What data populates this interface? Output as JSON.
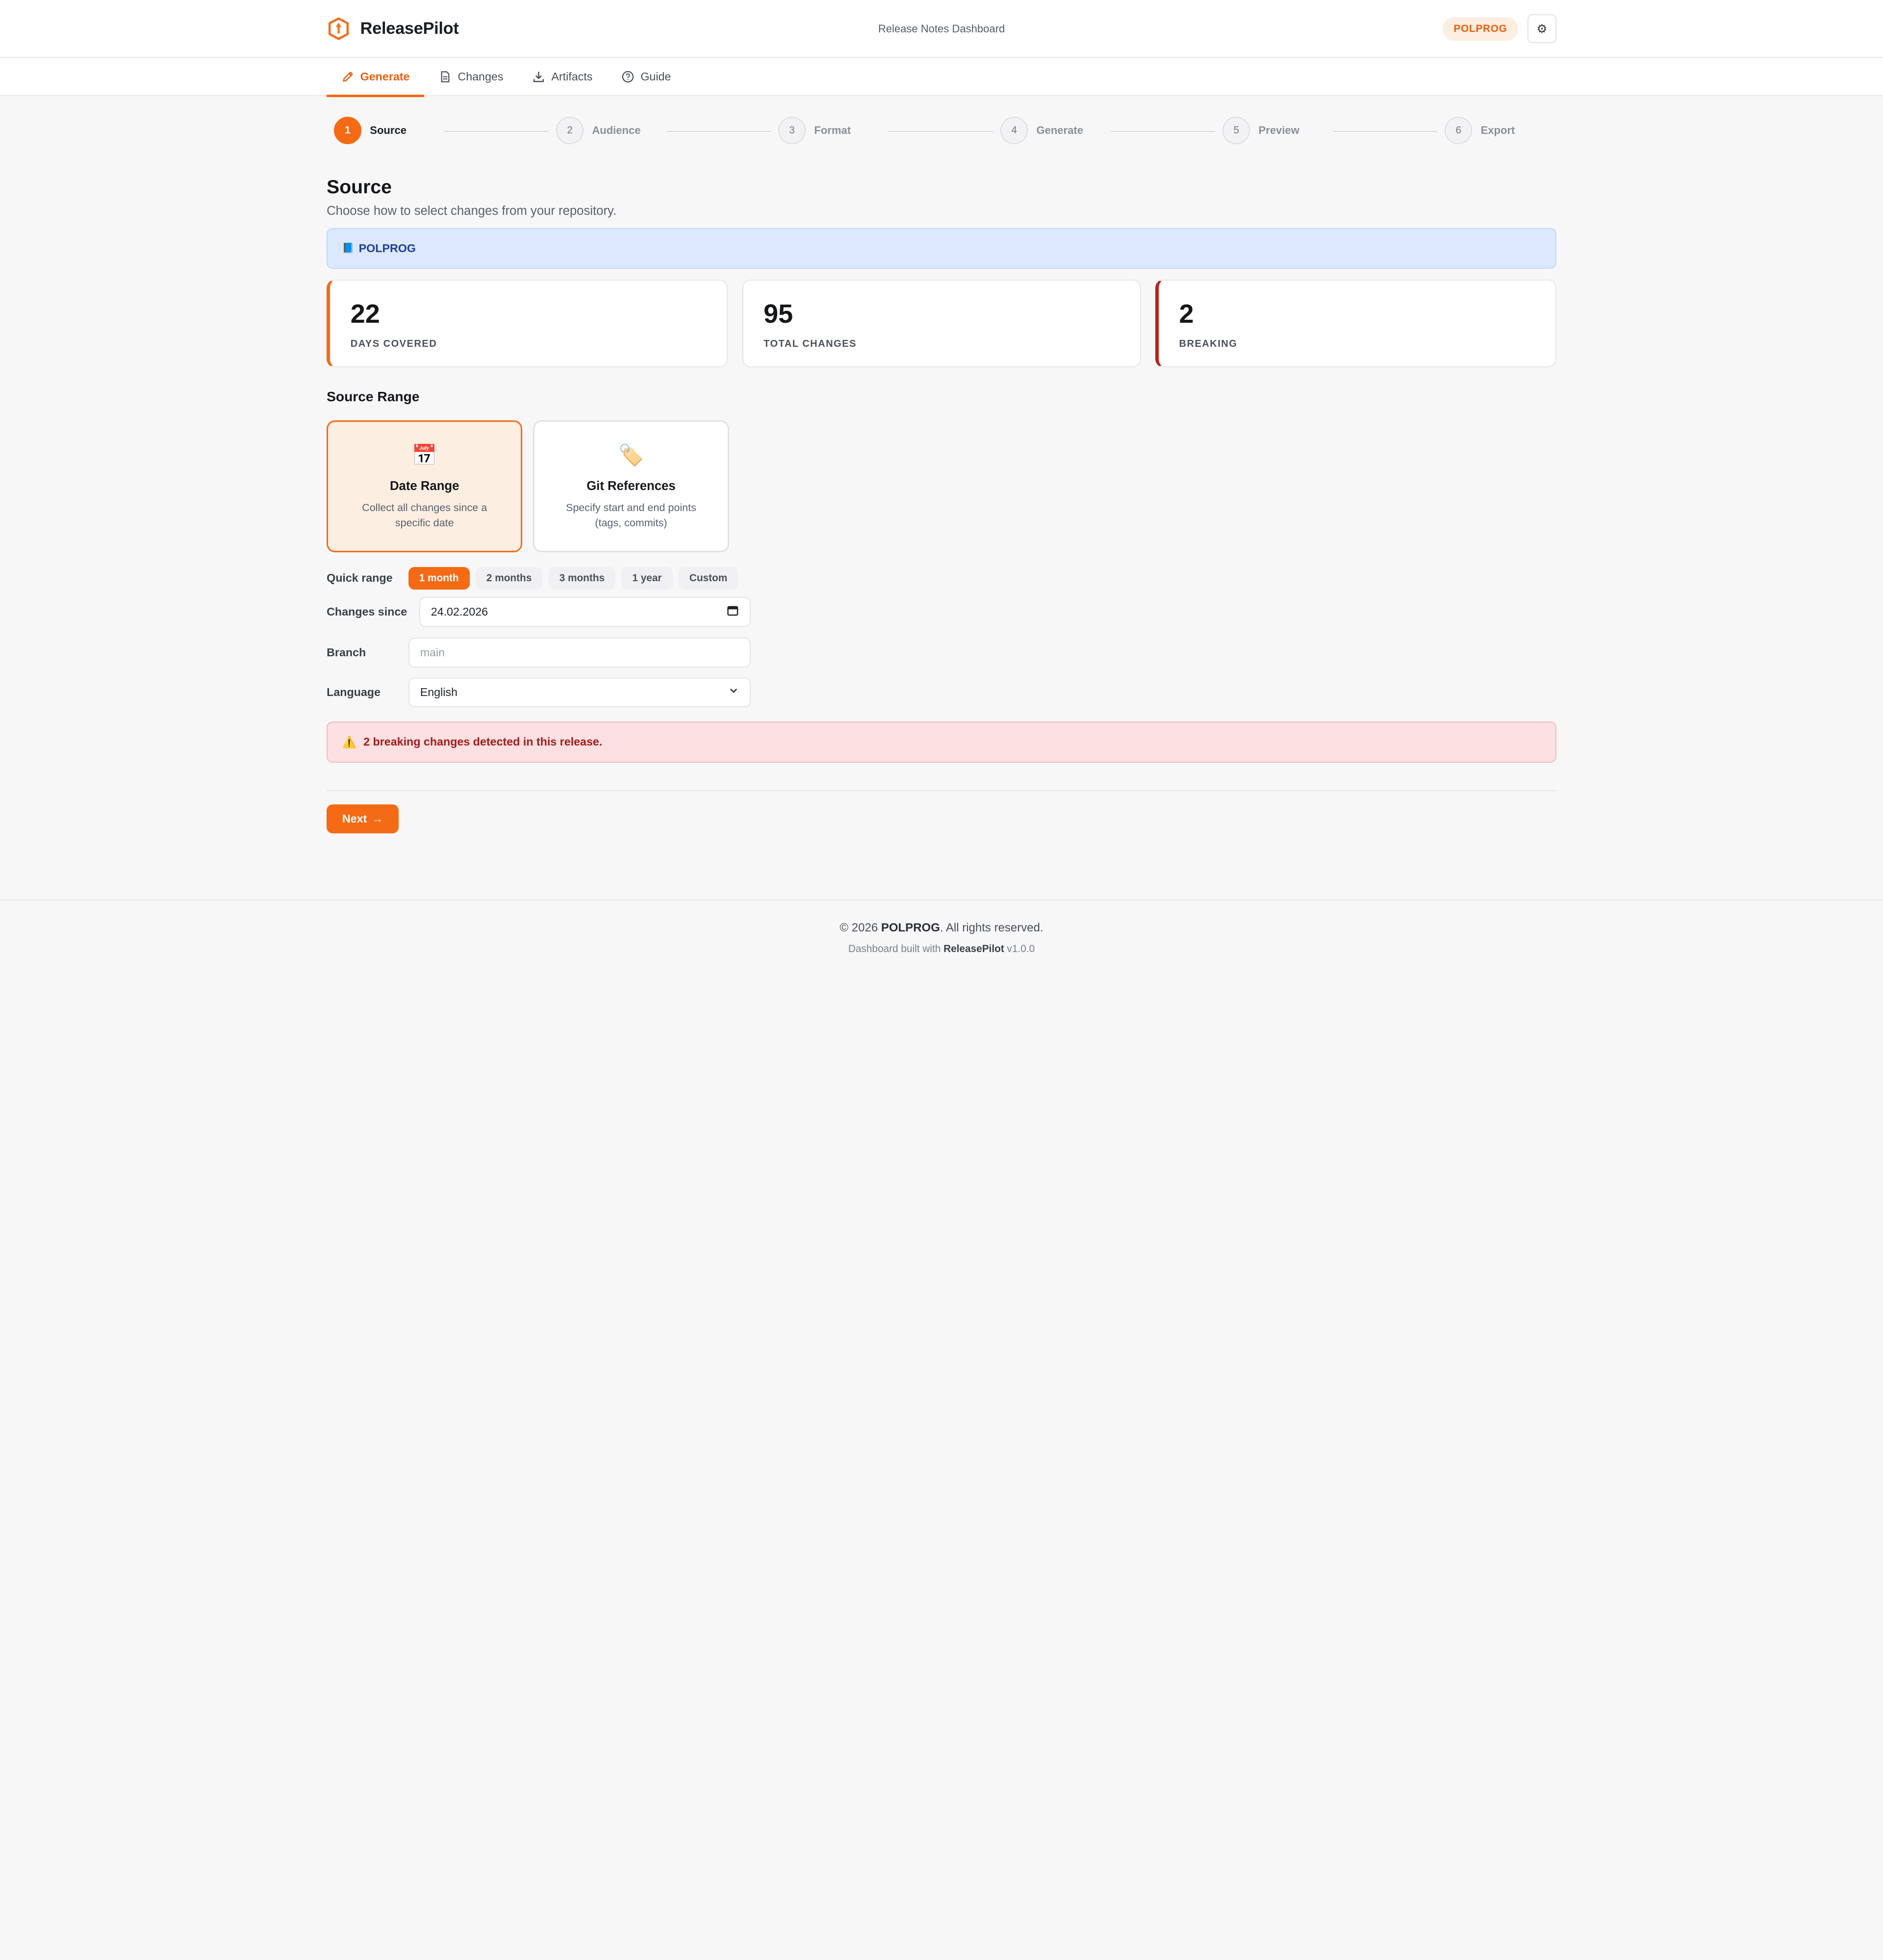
{
  "app": {
    "name": "ReleasePilot",
    "header_center": "Release Notes Dashboard",
    "org_badge": "POLPROG",
    "settings_icon": "gear-icon",
    "accent_color": "#f56a14"
  },
  "tabs": [
    {
      "label": "Generate",
      "icon": "pencil-icon",
      "active": true
    },
    {
      "label": "Changes",
      "icon": "document-icon",
      "active": false
    },
    {
      "label": "Artifacts",
      "icon": "download-icon",
      "active": false
    },
    {
      "label": "Guide",
      "icon": "help-circle-icon",
      "active": false
    }
  ],
  "stepper": [
    {
      "number": "1",
      "label": "Source",
      "active": true
    },
    {
      "number": "2",
      "label": "Audience",
      "active": false
    },
    {
      "number": "3",
      "label": "Format",
      "active": false
    },
    {
      "number": "4",
      "label": "Generate",
      "active": false
    },
    {
      "number": "5",
      "label": "Preview",
      "active": false
    },
    {
      "number": "6",
      "label": "Export",
      "active": false
    }
  ],
  "section": {
    "title": "Source",
    "subtitle": "Choose how to select changes from your repository."
  },
  "repo_banner": {
    "icon": "book-icon",
    "label": "POLPROG"
  },
  "stats": [
    {
      "value": "22",
      "label": "DAYS COVERED",
      "accent": "#f56a14"
    },
    {
      "value": "95",
      "label": "TOTAL CHANGES",
      "accent": null
    },
    {
      "value": "2",
      "label": "BREAKING",
      "accent": "#b42318"
    }
  ],
  "source_range": {
    "title": "Source Range",
    "options": [
      {
        "icon": "calendar-icon",
        "title": "Date Range",
        "description": "Collect all changes since a specific date",
        "selected": true
      },
      {
        "icon": "tag-icon",
        "title": "Git References",
        "description": "Specify start and end points (tags, commits)",
        "selected": false
      }
    ]
  },
  "form": {
    "quick_range_label": "Quick range",
    "quick_range_options": [
      "1 month",
      "2 months",
      "3 months",
      "1 year",
      "Custom"
    ],
    "quick_range_selected": "1 month",
    "changes_since_label": "Changes since",
    "changes_since_value": "24.02.2026",
    "branch_label": "Branch",
    "branch_placeholder": "main",
    "language_label": "Language",
    "language_value": "English"
  },
  "alert": {
    "icon": "warning-icon",
    "text": "2 breaking changes detected in this release."
  },
  "next_button": {
    "label": "Next",
    "arrow": "→"
  },
  "footer": {
    "copyright_prefix": "© 2026",
    "copyright_org": "POLPROG",
    "copyright_suffix": ". All rights reserved.",
    "built_prefix": "Dashboard built with",
    "built_name": "ReleasePilot",
    "built_version": "v1.0.0"
  }
}
